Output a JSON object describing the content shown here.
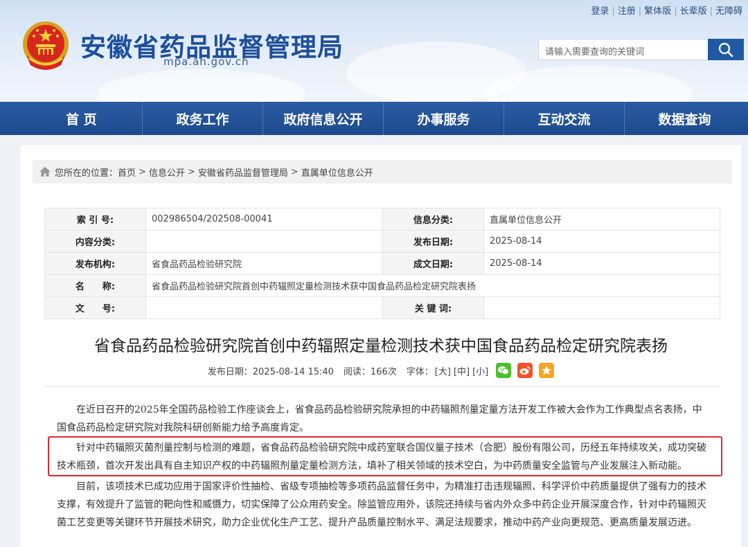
{
  "header": {
    "top_links": [
      "登录",
      "注册",
      "繁体版",
      "长辈版",
      "无障碍"
    ],
    "site_title": "安徽省药品监督管理局",
    "site_domain": "mpa.ah.gov.cn",
    "search_placeholder": "请输入需要查询的关键词",
    "search_icon": "search-icon"
  },
  "nav": [
    "首 页",
    "政务工作",
    "政府信息公开",
    "办事服务",
    "互动交流",
    "数据查询"
  ],
  "breadcrumb": {
    "prefix": "您所在的位置：",
    "items": [
      "首页",
      "信息公开",
      "安徽省药品监督管理局",
      "直属单位信息公开"
    ],
    "separator": ">"
  },
  "meta_table": {
    "index_label": "索 引 号:",
    "index_value": "002986504/202508-00041",
    "category_label": "信息分类:",
    "category_value": "直属单位信息公开",
    "content_type_label": "内容分类:",
    "content_type_value": "",
    "publish_date_label": "发布日期:",
    "publish_date_value": "2025-08-14",
    "issuer_label": "发布机构:",
    "issuer_value": "省食品药品检验研究院",
    "created_date_label": "成文日期:",
    "created_date_value": "2025-08-14",
    "name_label": "名　　称:",
    "name_value": "省食品药品检验研究院首创中药辐照定量检测技术获中国食品药品检定研究院表扬",
    "doc_no_label": "文　　号:",
    "doc_no_value": "",
    "keywords_label": "关 键 词:",
    "keywords_value": ""
  },
  "article": {
    "title": "省食品药品检验研究院首创中药辐照定量检测技术获中国食品药品检定研究院表扬",
    "published": "发布日期：2025-08-14 15:40",
    "reads": "阅读：166次",
    "font_label": "字体：",
    "font_sizes": [
      "[大]",
      "[中]",
      "[小]"
    ],
    "share_icons": [
      "wechat-icon",
      "weibo-icon",
      "favorite-icon"
    ],
    "paragraphs": [
      "在近日召开的2025年全国药品检验工作座谈会上，省食品药品检验研究院承担的中药辐照剂量定量方法开发工作被大会作为工作典型点名表扬，中国食品药品检定研究院对我院科研创新能力给予高度肯定。",
      "针对中药辐照灭菌剂量控制与检测的难题，省食品药品检验研究院中成药室联合国仪量子技术（合肥）股份有限公司，历经五年持续攻关，成功突破技术瓶颈，首次开发出具有自主知识产权的中药辐照剂量定量检测方法，填补了相关领域的技术空白，为中药质量安全监管与产业发展注入新动能。",
      "目前，该项技术已成功应用于国家评价性抽检、省级专项抽检等多项药品监督任务中，为精准打击违规辐照、科学评价中药质量提供了强有力的技术支撑，有效提升了监管的靶向性和威慑力，切实保障了公众用药安全。除监管应用外，该院还持续与省内外众多中药企业开展深度合作，针对中药辐照灭菌工艺变更等关键环节开展技术研究，助力企业优化生产工艺、提升产品质量控制水平、满足法规要求，推动中药产业向更规范、更高质量发展迈进。"
    ]
  },
  "colors": {
    "brand_blue": "#1f4f95",
    "title_blue": "#1d4f9c",
    "highlight_red": "#e0262e"
  }
}
